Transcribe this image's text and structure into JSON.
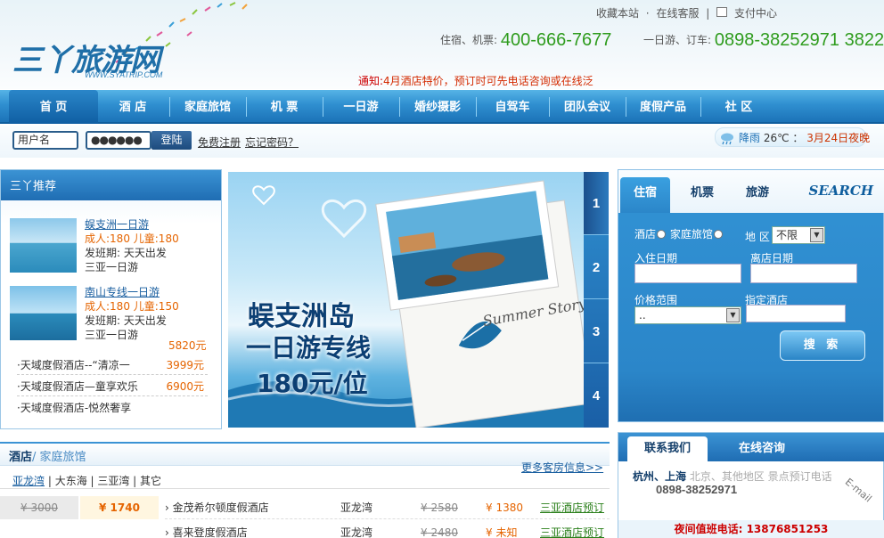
{
  "header": {
    "logo_text": "三丫旅游网",
    "logo_sub": "WWW.SYATRIP.COM",
    "top_links": [
      "收藏本站",
      "·",
      "在线客服",
      "|",
      "支付中心"
    ],
    "hotline1_label": "住宿、机票:",
    "hotline1_number": "400-666-7677",
    "hotline2_label": "一日游、订车:",
    "hotline2_number": "0898-38252971  3822",
    "notice_prefix": "通知:",
    "notice_text": "4月酒店特价，预订时可先电话咨询或在线泛"
  },
  "nav": [
    "首 页",
    "酒 店",
    "家庭旅馆",
    "机 票",
    "一日游",
    "婚纱摄影",
    "自驾车",
    "团队会议",
    "度假产品",
    "社 区"
  ],
  "login": {
    "username_value": "用户名",
    "password_value": "●●●●●●",
    "login_button": "登陆",
    "register_link": "免费注册",
    "forgot_link": "忘记密码？"
  },
  "weather": {
    "condition": "降雨",
    "temperature": "26℃",
    "separator": "：",
    "date_text": "3月24日夜晚"
  },
  "recommend": {
    "title": "三丫推荐",
    "items": [
      {
        "title": "蜈支洲一日游",
        "price_line": "成人:180  儿童:180",
        "schedule": "发班期:  天天出发",
        "category": "三亚一日游"
      },
      {
        "title": "南山专线一日游",
        "price_line": "成人:180  儿童:150",
        "schedule": "发班期:  天天出发",
        "category": "三亚一日游"
      }
    ],
    "extra_price": "5820元",
    "hotels": [
      {
        "name": "·天域度假酒店--“清凉一",
        "price": "3999元"
      },
      {
        "name": "·天域度假酒店—童享欢乐",
        "price": "6900元"
      },
      {
        "name": "·天域度假酒店-悦然奢享",
        "price": ""
      }
    ]
  },
  "banner": {
    "title_line1": "蜈支洲岛",
    "title_line2": "一日游专线",
    "title_line3": "180元/位",
    "card_text": "Summer Story",
    "tabs": [
      "1",
      "2",
      "3",
      "4"
    ]
  },
  "search": {
    "tabs": [
      "住宿",
      "机票",
      "旅游"
    ],
    "logo": "SEARCH",
    "type_hotel": "酒店",
    "type_inn": "家庭旅馆",
    "district_label": "地 区",
    "district_value": "不限",
    "checkin_label": "入住日期",
    "checkout_label": "离店日期",
    "price_label": "价格范围",
    "price_value": "..",
    "hotel_label": "指定酒店",
    "button": "搜 索"
  },
  "hotels_section": {
    "title": "酒店",
    "title_sub": "/ 家庭旅馆",
    "more": "更多客房信息>>",
    "areas": [
      "亚龙湾",
      " | 大东海 | 三亚湾 | 其它"
    ],
    "promo_old": "¥ 3000",
    "promo_new": "¥ 1740",
    "rows": [
      {
        "name": "› 金茂希尔顿度假酒店",
        "area": "亚龙湾",
        "old": "¥ 2580",
        "new": "¥ 1380",
        "link": "三亚酒店预订"
      },
      {
        "name": "› 喜来登度假酒店",
        "area": "亚龙湾",
        "old": "¥ 2480",
        "new": "¥ 未知",
        "link": "三亚酒店预订"
      }
    ]
  },
  "contact": {
    "tabs": [
      "联系我们",
      "在线咨询"
    ],
    "cities_active": "杭州、上海",
    "cities_rest": "  北京、其他地区   景点预订电话",
    "phone": "0898-38252971",
    "email_tag": "E-mail",
    "night_label": "夜间值班电话:",
    "night_number": "13876851253"
  },
  "colors": {
    "nav_blue": "#2f8fd0",
    "hotline_green": "#2f9c1e",
    "price_orange": "#e56400",
    "notice_red": "#d32a00"
  }
}
